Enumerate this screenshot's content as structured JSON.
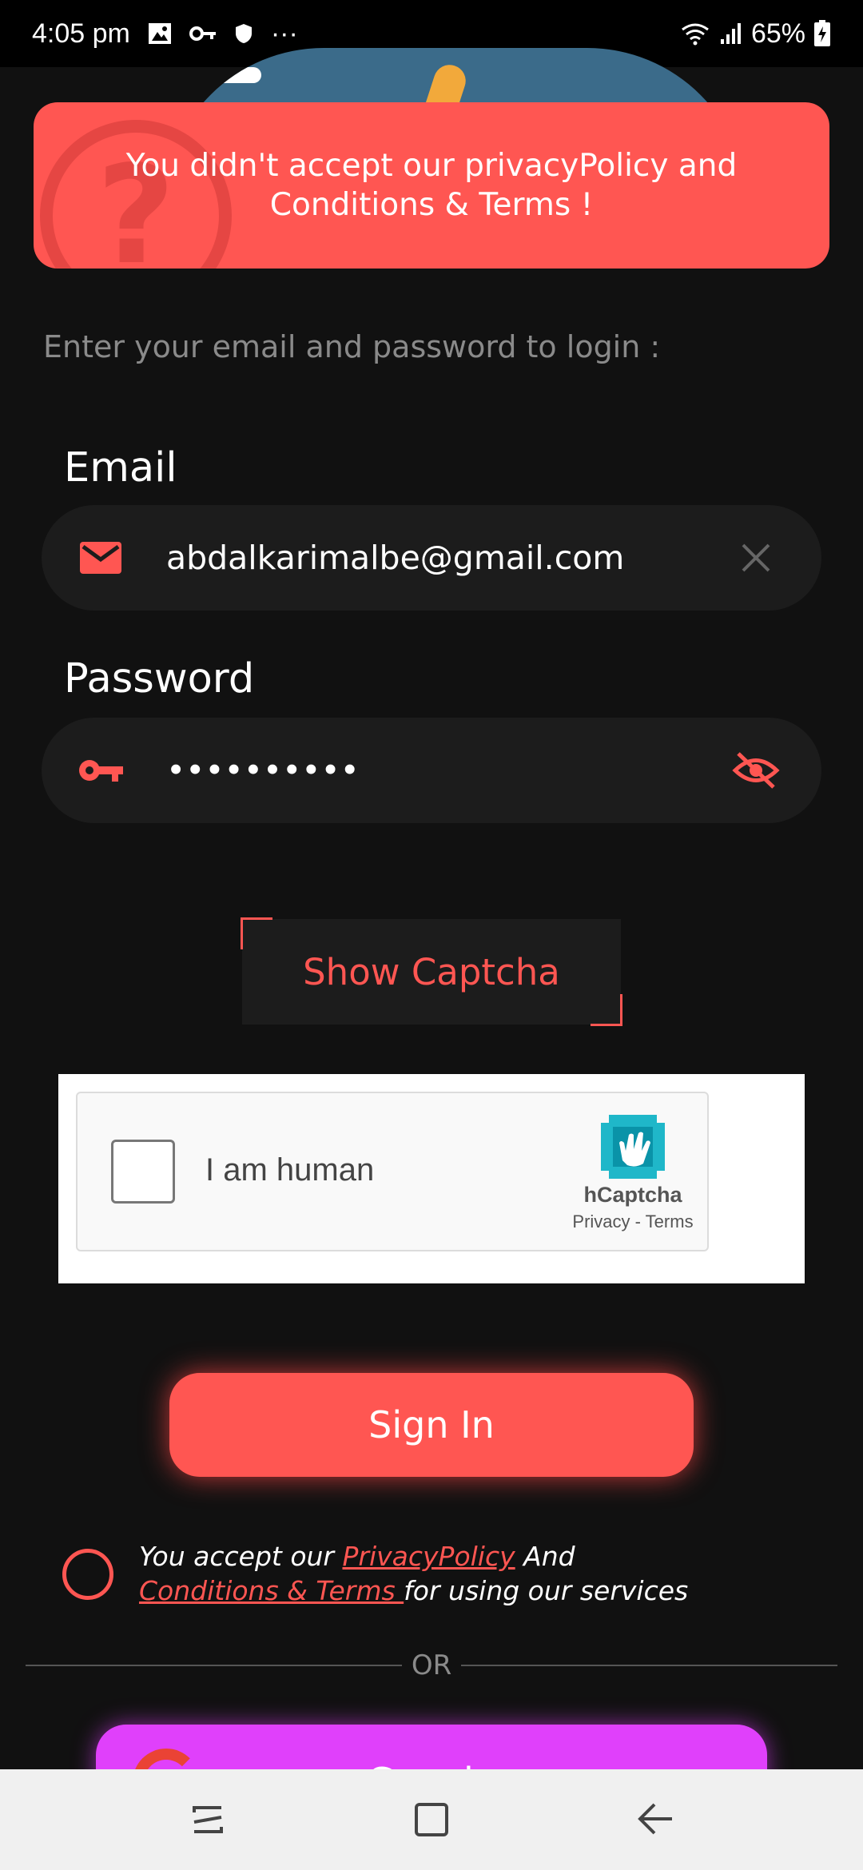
{
  "status_bar": {
    "time": "4:05 pm",
    "battery": "65%",
    "more": "···"
  },
  "toast": {
    "message": "You didn't accept our privacyPolicy and Conditions & Terms !"
  },
  "login": {
    "prompt": "Enter your email and password to login :",
    "email_label": "Email",
    "email_value": "abdalkarimalbe@gmail.com",
    "password_label": "Password",
    "password_value": "••••••••••",
    "show_captcha": "Show Captcha",
    "sign_in": "Sign In"
  },
  "captcha": {
    "label": "I am human",
    "brand": "hCaptcha",
    "links": "Privacy - Terms"
  },
  "terms": {
    "prefix": "You accept our ",
    "privacy_link": "PrivacyPolicy",
    "middle": " And",
    "conditions_link": " Conditions & Terms ",
    "suffix": "for using our services"
  },
  "divider": {
    "or": "OR"
  },
  "google": {
    "label": "Google"
  },
  "colors": {
    "accent": "#ff5652",
    "background": "#111111",
    "field": "#1c1c1c",
    "google_button": "#e040fb"
  }
}
